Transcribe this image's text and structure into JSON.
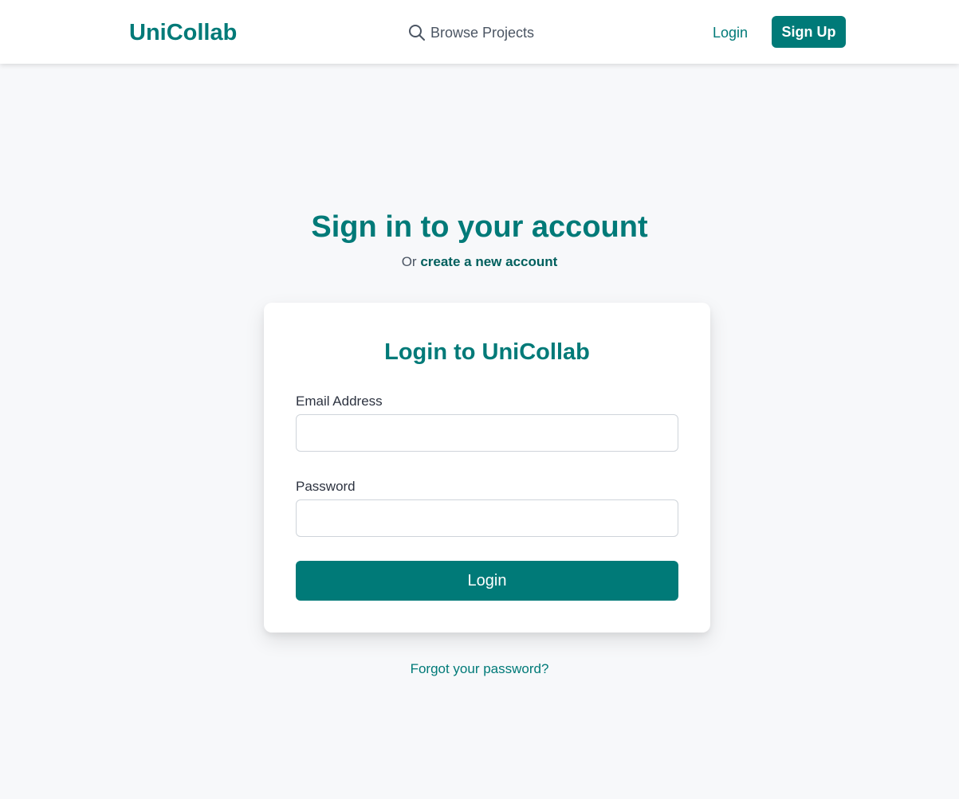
{
  "colors": {
    "brand": "#007a78",
    "background": "#f7f8fa",
    "link_dark": "#005f5d"
  },
  "navbar": {
    "brand": "UniCollab",
    "browse_icon": "search-icon",
    "browse_label": "Browse Projects",
    "login_label": "Login",
    "signup_label": "Sign Up"
  },
  "page": {
    "heading": "Sign in to your account",
    "sub_prefix": "Or",
    "sub_link": "create a new account"
  },
  "form": {
    "title": "Login to UniCollab",
    "email_label": "Email Address",
    "email_value": "",
    "password_label": "Password",
    "password_value": "",
    "submit_label": "Login"
  },
  "footer": {
    "forgot_label": "Forgot your password?"
  }
}
